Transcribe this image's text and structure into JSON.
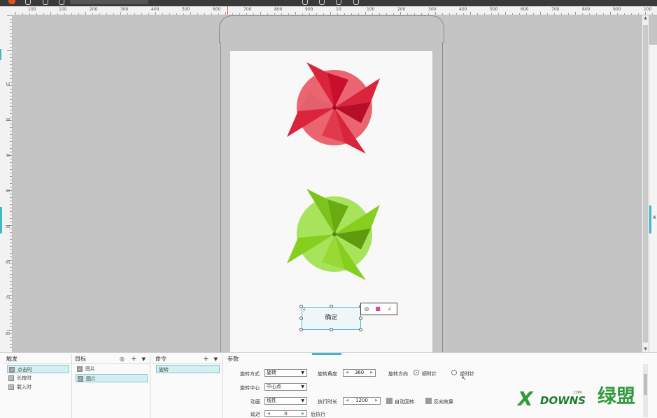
{
  "ruler": {
    "h_labels": [
      "100",
      "100",
      "200",
      "300",
      "400",
      "500",
      "600",
      "700",
      "800",
      "900",
      "10",
      "100",
      "200",
      "300",
      "400",
      "500",
      "600",
      "700",
      "800",
      "900",
      "100"
    ],
    "v_labels": [
      "10",
      "20",
      "30",
      "40",
      "50",
      "60",
      "70",
      "80"
    ]
  },
  "canvas": {
    "confirm_button_label": "确定"
  },
  "panel": {
    "trigger": {
      "header": "触发",
      "items": [
        {
          "label": "点击时",
          "checked": true,
          "selected": true
        },
        {
          "label": "长按时",
          "checked": false,
          "selected": false
        },
        {
          "label": "载入时",
          "checked": false,
          "selected": false
        }
      ]
    },
    "target": {
      "header": "目标",
      "add_icon": "plus-icon",
      "items": [
        {
          "label": "图片",
          "checked": true,
          "selected": false
        },
        {
          "label": "图片",
          "checked": true,
          "selected": true
        }
      ]
    },
    "command": {
      "header": "命令",
      "items": [
        {
          "label": "旋转",
          "selected": true
        }
      ]
    },
    "params": {
      "header": "参数",
      "rotate_mode_label": "旋转方式",
      "rotate_mode_value": "旋转",
      "rotate_angle_label": "旋转角度",
      "rotate_angle_value": "360",
      "rotate_dir_label": "旋转方向",
      "clockwise_label": "顺时针",
      "counterclockwise_label": "逆时针",
      "rotate_center_label": "旋转中心",
      "rotate_center_value": "中心点",
      "animation_label": "动画",
      "animation_value": "线性",
      "duration_label": "执行时长",
      "duration_value": "1200",
      "auto_return_label": "自动回转",
      "reverse_label": "反向效果",
      "delay_label": "延迟",
      "delay_value": "0",
      "after_exec_label": "后执行"
    }
  },
  "watermark": {
    "downs": "DOWNS",
    "com": ".COM",
    "cn": "绿盟"
  },
  "colors": {
    "accent": "#3fb8c9",
    "pinwheel_red": "#d9253b",
    "pinwheel_green": "#86cf1f"
  }
}
